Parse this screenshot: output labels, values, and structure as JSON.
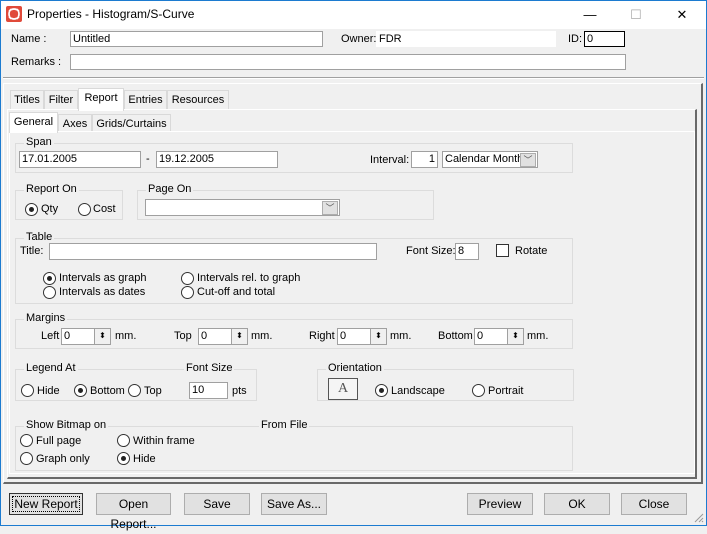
{
  "window": {
    "title": "Properties - Histogram/S-Curve",
    "controls": {
      "minimize": "—",
      "maximize": "☐",
      "close": "✕"
    }
  },
  "header": {
    "name_label": "Name :",
    "name_value": "Untitled",
    "owner_label": "Owner:",
    "owner_value": "FDR",
    "id_label": "ID:",
    "id_value": "0",
    "remarks_label": "Remarks :",
    "remarks_value": ""
  },
  "tabs": [
    {
      "label": "Titles",
      "active": false
    },
    {
      "label": "Filter",
      "active": false
    },
    {
      "label": "Report",
      "active": true
    },
    {
      "label": "Entries",
      "active": false
    },
    {
      "label": "Resources",
      "active": false
    }
  ],
  "subtabs": [
    {
      "label": "General",
      "active": true
    },
    {
      "label": "Axes",
      "active": false
    },
    {
      "label": "Grids/Curtains",
      "active": false
    }
  ],
  "span": {
    "title": "Span",
    "from": "17.01.2005",
    "separator": "-",
    "to": "19.12.2005",
    "interval_label": "Interval:",
    "interval_value": "1",
    "interval_unit": "Calendar Month"
  },
  "report_on": {
    "title": "Report On",
    "options": [
      {
        "label": "Qty",
        "selected": true
      },
      {
        "label": "Cost",
        "selected": false
      }
    ]
  },
  "page_on": {
    "title": "Page On",
    "value": ""
  },
  "table": {
    "title": "Table",
    "title_label": "Title:",
    "title_value": "",
    "font_size_label": "Font Size:",
    "font_size_value": "8",
    "rotate_label": "Rotate",
    "rotate_checked": false,
    "options": [
      {
        "label": "Intervals as graph",
        "selected": true
      },
      {
        "label": "Intervals as dates",
        "selected": false
      },
      {
        "label": "Intervals rel. to graph",
        "selected": false
      },
      {
        "label": "Cut-off and total",
        "selected": false
      }
    ]
  },
  "margins": {
    "title": "Margins",
    "unit": "mm.",
    "fields": [
      {
        "label": "Left",
        "value": "0"
      },
      {
        "label": "Top",
        "value": "0"
      },
      {
        "label": "Right",
        "value": "0"
      },
      {
        "label": "Bottom",
        "value": "0"
      }
    ]
  },
  "legend": {
    "title": "Legend At",
    "options": [
      {
        "label": "Hide",
        "selected": false
      },
      {
        "label": "Bottom",
        "selected": true
      },
      {
        "label": "Top",
        "selected": false
      }
    ],
    "font_size_title": "Font Size",
    "font_size_value": "10",
    "font_size_unit": "pts"
  },
  "orientation": {
    "title": "Orientation",
    "icon_glyph": "A",
    "options": [
      {
        "label": "Landscape",
        "selected": true
      },
      {
        "label": "Portrait",
        "selected": false
      }
    ]
  },
  "bitmap": {
    "title": "Show Bitmap on",
    "from_file_title": "From File",
    "options": [
      {
        "label": "Full page",
        "selected": false
      },
      {
        "label": "Graph only",
        "selected": false
      },
      {
        "label": "Within frame",
        "selected": false
      },
      {
        "label": "Hide",
        "selected": true
      }
    ]
  },
  "buttons": {
    "new_report": "New Report",
    "open_report": "Open Report...",
    "save": "Save",
    "save_as": "Save As...",
    "preview": "Preview",
    "ok": "OK",
    "close": "Close"
  }
}
